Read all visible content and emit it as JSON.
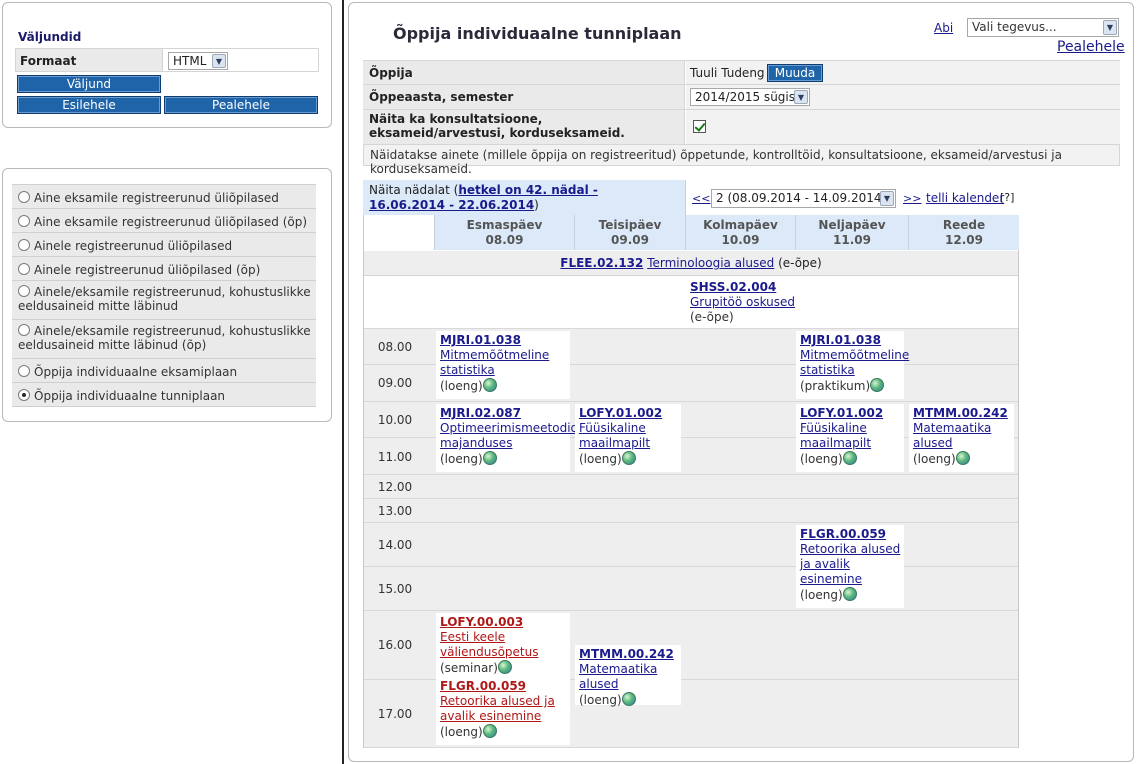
{
  "output": {
    "heading": "Väljundid",
    "format_label": "Formaat",
    "format_value": "HTML",
    "output_button": "Väljund",
    "home_button": "Esilehele",
    "main_button": "Pealehele"
  },
  "nav": {
    "items": [
      {
        "label": "Aine eksamile registreerunud üliõpilased",
        "selected": false
      },
      {
        "label": "Aine eksamile registreerunud üliõpilased (õp)",
        "selected": false
      },
      {
        "label": "Ainele registreerunud üliõpilased",
        "selected": false
      },
      {
        "label": "Ainele registreerunud üliõpilased (õp)",
        "selected": false
      },
      {
        "label": "Ainele/eksamile registreerunud, kohustuslikke eeldusaineid mitte läbinud",
        "selected": false
      },
      {
        "label": "Ainele/eksamile registreerunud, kohustuslikke eeldusaineid mitte läbinud (õp)",
        "selected": false
      },
      {
        "label": "Õppija individuaalne eksamiplaan",
        "selected": false
      },
      {
        "label": "Õppija individuaalne tunniplaan",
        "selected": true
      }
    ]
  },
  "main": {
    "title": "Õppija individuaalne tunniplaan",
    "help_link": "Abi",
    "action_select": "Vali tegevus...",
    "main_link": "Pealehele",
    "form": {
      "student_label": "Õppija",
      "student_value": "Tuuli Tudeng",
      "change_button": "Muuda",
      "year_label": "Õppeaasta, semester",
      "year_value": "2014/2015 sügis",
      "consult_label": "Näita ka konsultatsioone, eksameid/arvestusi, korduseksameid.",
      "info_text": "Näidatakse ainete (millele õppija on registreeritud) õppetunde, kontrolltöid, konsultatsioone, eksameid/arvestusi ja korduseksameid."
    },
    "week": {
      "show_label": "Näita nädalat (",
      "current_link": "hetkel on 42. nädal - 16.06.2014 - 22.06.2014",
      "close_paren": ")",
      "prev": "<<",
      "selected_week": "2 (08.09.2014 - 14.09.2014)",
      "next": ">>",
      "calendar_link": "telli kalender",
      "help_mark": "[?]"
    },
    "days": [
      {
        "name": "Esmaspäev",
        "date": "08.09"
      },
      {
        "name": "Teisipäev",
        "date": "09.09"
      },
      {
        "name": "Kolmapäev",
        "date": "10.09"
      },
      {
        "name": "Neljapäev",
        "date": "11.09"
      },
      {
        "name": "Reede",
        "date": "12.09"
      }
    ],
    "allweek_event": {
      "code": "FLEE.02.132",
      "name": "Terminoloogia alused",
      "type": "(e-õpe)"
    },
    "wednesday_event": {
      "code": "SHSS.02.004",
      "name": "Grupitöö oskused",
      "type": "(e-õpe)"
    },
    "times": [
      "08.00",
      "09.00",
      "10.00",
      "11.00",
      "12.00",
      "13.00",
      "14.00",
      "15.00",
      "16.00",
      "17.00"
    ],
    "events": [
      {
        "code": "MJRI.01.038",
        "name_lines": [
          "Mitmemõõtmeline",
          "statistika"
        ],
        "type": "(loeng)",
        "red": false
      },
      {
        "code": "MJRI.01.038",
        "name_lines": [
          "Mitmemõõtmeline",
          "statistika"
        ],
        "type": "(praktikum)",
        "red": false
      },
      {
        "code": "MJRI.02.087",
        "name_lines": [
          "Optimeerimismeetodid",
          "majanduses"
        ],
        "type": "(loeng)",
        "red": false
      },
      {
        "code": "LOFY.01.002",
        "name_lines": [
          "Füüsikaline",
          "maailmapilt"
        ],
        "type": "(loeng)",
        "red": false
      },
      {
        "code": "LOFY.01.002",
        "name_lines": [
          "Füüsikaline",
          "maailmapilt"
        ],
        "type": "(loeng)",
        "red": false
      },
      {
        "code": "MTMM.00.242",
        "name_lines": [
          "Matemaatika",
          "alused"
        ],
        "type": "(loeng)",
        "red": false
      },
      {
        "code": "FLGR.00.059",
        "name_lines": [
          "Retoorika alused",
          "ja avalik",
          "esinemine"
        ],
        "type": "(loeng)",
        "red": false
      },
      {
        "code": "LOFY.00.003",
        "name_lines": [
          "Eesti keele",
          "väliendusõpetus"
        ],
        "type": "(seminar)",
        "red": true
      },
      {
        "code": "MTMM.00.242",
        "name_lines": [
          "Matemaatika",
          "alused"
        ],
        "type": "(loeng)",
        "red": false
      },
      {
        "code": "FLGR.00.059",
        "name_lines": [
          "Retoorika alused ja",
          "avalik esinemine"
        ],
        "type": "(loeng)",
        "red": true
      }
    ]
  }
}
